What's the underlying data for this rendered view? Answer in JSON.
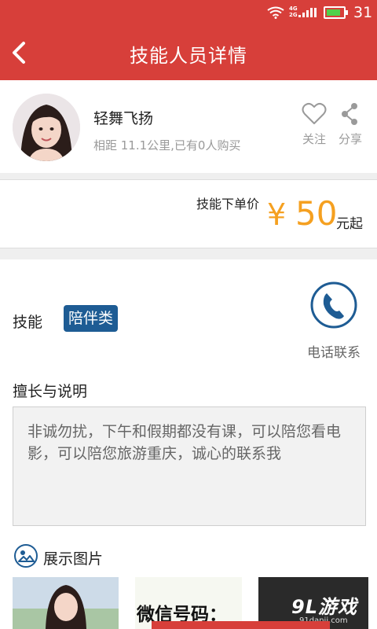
{
  "status_bar": {
    "network": "4G\n2G",
    "time": "31",
    "battery_level": 0.85
  },
  "header": {
    "title": "技能人员详情",
    "back_icon": "chevron-left-icon"
  },
  "profile": {
    "name": "轻舞飞扬",
    "meta": "相距 11.1公里,已有0人购买",
    "follow_label": "关注",
    "share_label": "分享"
  },
  "price": {
    "label": "技能下单价",
    "symbol": "¥",
    "value": "50",
    "unit": "元起"
  },
  "skill": {
    "label": "技能",
    "tag": "陪伴类",
    "phone_label": "电话联系"
  },
  "description": {
    "title": "擅长与说明",
    "text": "非诚勿扰，下午和假期都没有课，可以陪您看电影，可以陪您旅游重庆，诚心的联系我"
  },
  "gallery": {
    "title": "展示图片",
    "wechat_text": "微信号码：",
    "watermark_logo": "9L游戏",
    "watermark_url": "91danji.com"
  },
  "colors": {
    "brand_red": "#d73f3a",
    "price_orange": "#f5a020",
    "tag_blue": "#1e5c94"
  }
}
